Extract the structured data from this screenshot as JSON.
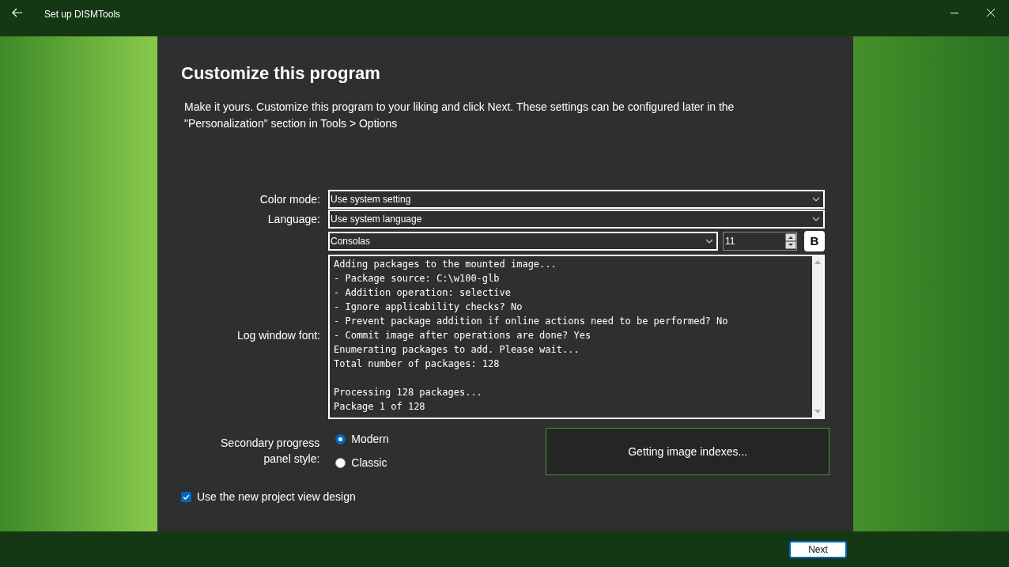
{
  "window": {
    "title": "Set up DISMTools"
  },
  "page": {
    "heading": "Customize this program",
    "intro": "Make it yours. Customize this program to your liking and click Next. These settings can be configured later in the \"Personalization\" section in Tools > Options"
  },
  "color_mode": {
    "label": "Color mode:",
    "value": "Use system setting"
  },
  "language": {
    "label": "Language:",
    "value": "Use system language"
  },
  "log_font": {
    "label": "Log window font:",
    "font": "Consolas",
    "size": "11",
    "bold_button": "B",
    "bold": false,
    "preview_blocks": [
      [
        "Adding packages to the mounted image...",
        "- Package source: C:\\w100-glb",
        "- Addition operation: selective",
        "- Ignore applicability checks? No",
        "- Prevent package addition if online actions need to be performed? No",
        "- Commit image after operations are done? Yes",
        "Enumerating packages to add. Please wait...",
        "Total number of packages: 128"
      ],
      [
        "Processing 128 packages...",
        "Package 1 of 128"
      ]
    ]
  },
  "progress_style": {
    "label": "Secondary progress panel style:",
    "options": [
      {
        "label": "Modern",
        "selected": true
      },
      {
        "label": "Classic",
        "selected": false
      }
    ],
    "preview": "Getting image indexes..."
  },
  "project_view": {
    "label": "Use the new project view design",
    "checked": true
  },
  "buttons": {
    "next": "Next"
  }
}
